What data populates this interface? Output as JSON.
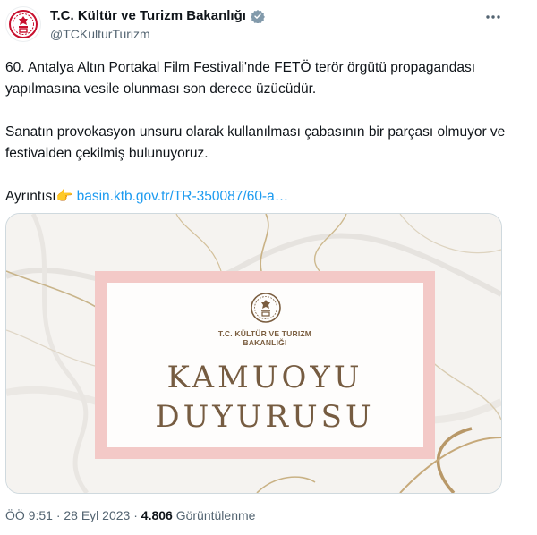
{
  "account": {
    "display_name": "T.C. Kültür ve Turizm Bakanlığı",
    "handle": "@TCKulturTurizm"
  },
  "tweet": {
    "paragraph1": "60. Antalya Altın Portakal Film Festivali'nde FETÖ terör örgütü propagandası yapılmasına vesile olunması son derece üzücüdür.",
    "paragraph2": "Sanatın provokasyon unsuru olarak kullanılması çabasının bir parçası olmuyor ve festivalden çekilmiş bulunuyoruz.",
    "details_label": "Ayrıntısı",
    "details_emoji": "👉",
    "link_text": "basin.ktb.gov.tr/TR-350087/60-a…"
  },
  "media": {
    "ministry_line1": "T.C. KÜLTÜR VE TURIZM",
    "ministry_line2": "BAKANLIĞI",
    "title_line1": "KAMUOYU",
    "title_line2": "DUYURUSU"
  },
  "meta": {
    "time": "ÖÖ 9:51",
    "separator": "·",
    "date": "28 Eyl 2023",
    "views_count": "4.806",
    "views_label": "Görüntülenme"
  },
  "icons": {
    "verified": "verified-badge-icon",
    "more": "more-icon",
    "avatar": "ministry-emblem-icon"
  },
  "colors": {
    "brand_red": "#c8102e",
    "link": "#1d9bf0",
    "verified": "#829aab",
    "muted": "#536471",
    "frame_pink": "#f3c9c7",
    "title_brown": "#765c41"
  }
}
